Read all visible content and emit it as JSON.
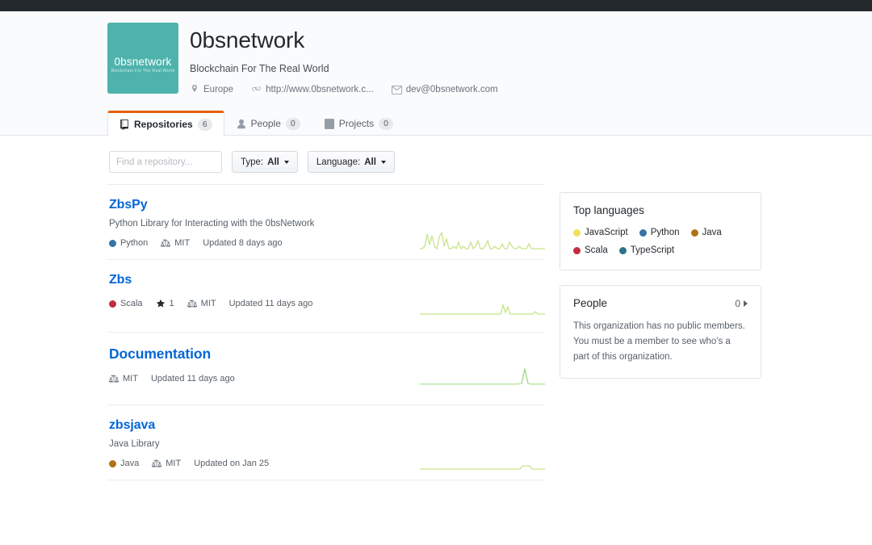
{
  "topbar": {
    "color": "#24292e"
  },
  "org": {
    "name": "0bsnetwork",
    "description": "Blockchain For The Real World",
    "avatar": {
      "name": "0bsnetwork",
      "tagline": "Blockchain For The Real World",
      "color": "#4fb3ad"
    },
    "meta": {
      "location": "Europe",
      "website": "http://www.0bsnetwork.c...",
      "email": "dev@0bsnetwork.com"
    }
  },
  "tabs": [
    {
      "label": "Repositories",
      "count": "6",
      "icon": "repo-icon",
      "active": true
    },
    {
      "label": "People",
      "count": "0",
      "icon": "person-icon",
      "active": false
    },
    {
      "label": "Projects",
      "count": "0",
      "icon": "project-icon",
      "active": false
    }
  ],
  "filters": {
    "search_placeholder": "Find a repository...",
    "search_value": "",
    "type_label": "Type:",
    "type_value": "All",
    "language_label": "Language:",
    "language_value": "All"
  },
  "repositories": [
    {
      "name": "ZbsPy",
      "description": "Python Library for Interacting with the 0bsNetwork",
      "language": "Python",
      "language_color": "#3572A5",
      "stars": null,
      "license": "MIT",
      "updated": "Updated 8 days ago"
    },
    {
      "name": "Zbs",
      "description": "",
      "language": "Scala",
      "language_color": "#c22d40",
      "stars": "1",
      "license": "MIT",
      "updated": "Updated 11 days ago"
    },
    {
      "name": "Documentation",
      "description": "",
      "language": "",
      "language_color": "",
      "stars": null,
      "license": "MIT",
      "updated": "Updated 11 days ago"
    },
    {
      "name": "zbsjava",
      "description": "Java Library",
      "language": "Java",
      "language_color": "#b07219",
      "stars": null,
      "license": "MIT",
      "updated": "Updated on Jan 25"
    }
  ],
  "sidebar": {
    "top_languages": {
      "title": "Top languages",
      "items": [
        {
          "name": "JavaScript",
          "color": "#f1e05a"
        },
        {
          "name": "Python",
          "color": "#3572A5"
        },
        {
          "name": "Java",
          "color": "#b07219"
        },
        {
          "name": "Scala",
          "color": "#c22d40"
        },
        {
          "name": "TypeScript",
          "color": "#2b7489"
        }
      ]
    },
    "people": {
      "title": "People",
      "count": "0",
      "body": "This organization has no public members. You must be a member to see who's a part of this organization."
    }
  },
  "chart_data": [
    {
      "type": "line",
      "title": "ZbsPy commit activity sparkline",
      "x": [
        0,
        1,
        2,
        3,
        4,
        5,
        6,
        7,
        8,
        9,
        10,
        11,
        12,
        13,
        14,
        15,
        16,
        17,
        18,
        19,
        20,
        21,
        22,
        23,
        24,
        25,
        26,
        27,
        28,
        29,
        30,
        31,
        32,
        33,
        34,
        35,
        36,
        37,
        38,
        39,
        40,
        41,
        42,
        43,
        44,
        45,
        46,
        47,
        48,
        49,
        50,
        51
      ],
      "values": [
        1,
        1,
        2,
        9,
        3,
        8,
        2,
        1,
        7,
        10,
        2,
        6,
        1,
        1,
        2,
        1,
        4,
        1,
        2,
        1,
        1,
        4,
        1,
        2,
        5,
        1,
        1,
        2,
        5,
        1,
        1,
        2,
        1,
        1,
        3,
        1,
        1,
        4,
        2,
        1,
        1,
        2,
        1,
        1,
        1,
        3,
        1,
        1,
        1,
        1,
        1,
        1
      ],
      "ylim": [
        0,
        10
      ],
      "color": "#c6e48b",
      "grid": false
    },
    {
      "type": "line",
      "title": "Zbs commit activity sparkline",
      "x": [
        0,
        1,
        2,
        3,
        4,
        5,
        6,
        7,
        8,
        9,
        10,
        11,
        12,
        13,
        14,
        15,
        16,
        17,
        18,
        19,
        20,
        21,
        22,
        23,
        24,
        25,
        26,
        27,
        28,
        29,
        30,
        31,
        32,
        33,
        34,
        35,
        36,
        37,
        38,
        39,
        40,
        41,
        42,
        43,
        44,
        45,
        46,
        47,
        48,
        49,
        50,
        51
      ],
      "values": [
        0,
        0,
        0,
        0,
        0,
        0,
        0,
        0,
        0,
        0,
        0,
        0,
        0,
        0,
        0,
        0,
        0,
        0,
        0,
        0,
        0,
        0,
        0,
        0,
        0,
        0,
        0,
        0,
        0,
        0,
        0,
        0,
        0,
        0,
        5,
        1,
        4,
        0,
        0,
        0,
        0,
        0,
        0,
        0,
        0,
        0,
        0,
        0,
        0,
        2,
        0,
        0
      ],
      "ylim": [
        0,
        10
      ],
      "color": "#c6e48b",
      "grid": false
    },
    {
      "type": "line",
      "title": "Documentation commit activity sparkline",
      "x": [
        0,
        1,
        2,
        3,
        4,
        5,
        6,
        7,
        8,
        9,
        10,
        11,
        12,
        13,
        14,
        15,
        16,
        17,
        18,
        19,
        20,
        21,
        22,
        23,
        24,
        25,
        26,
        27,
        28,
        29,
        30,
        31,
        32,
        33,
        34,
        35,
        36,
        37,
        38,
        39,
        40,
        41,
        42,
        43,
        44,
        45,
        46,
        47,
        48,
        49,
        50,
        51
      ],
      "values": [
        0,
        0,
        0,
        0,
        0,
        0,
        0,
        0,
        0,
        0,
        0,
        0,
        0,
        0,
        0,
        0,
        0,
        0,
        0,
        0,
        0,
        0,
        0,
        0,
        0,
        0,
        0,
        0,
        0,
        0,
        0,
        0,
        0,
        0,
        0,
        0,
        0,
        0,
        0,
        0,
        0,
        0,
        0,
        0,
        0,
        1,
        10,
        2,
        0,
        0,
        0,
        0
      ],
      "ylim": [
        0,
        10
      ],
      "color": "#7bc96f",
      "grid": false
    },
    {
      "type": "line",
      "title": "zbsjava commit activity sparkline",
      "x": [
        0,
        1,
        2,
        3,
        4,
        5,
        6,
        7,
        8,
        9,
        10,
        11,
        12,
        13,
        14,
        15,
        16,
        17,
        18,
        19,
        20,
        21,
        22,
        23,
        24,
        25,
        26,
        27,
        28,
        29,
        30,
        31,
        32,
        33,
        34,
        35,
        36,
        37,
        38,
        39,
        40,
        41,
        42,
        43,
        44,
        45,
        46,
        47,
        48,
        49,
        50,
        51
      ],
      "values": [
        0,
        0,
        0,
        0,
        0,
        0,
        0,
        0,
        0,
        0,
        0,
        0,
        0,
        0,
        0,
        0,
        0,
        0,
        0,
        0,
        0,
        0,
        0,
        0,
        0,
        0,
        0,
        0,
        0,
        0,
        0,
        0,
        0,
        0,
        0,
        0,
        0,
        0,
        0,
        0,
        0,
        0,
        0,
        2,
        2,
        0,
        0,
        0,
        0,
        0,
        0,
        0
      ],
      "ylim": [
        0,
        10
      ],
      "color": "#c6e48b",
      "grid": false
    }
  ]
}
